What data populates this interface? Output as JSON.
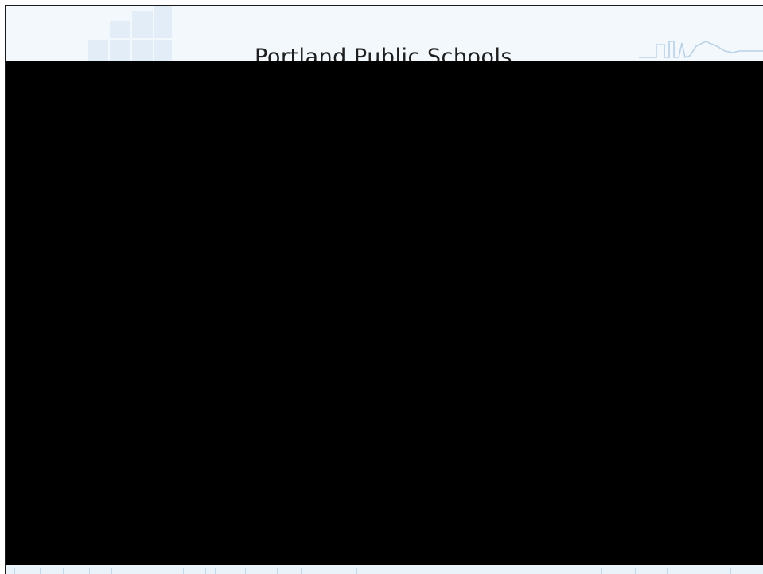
{
  "slide": {
    "title": "Portland Public Schools"
  },
  "colors": {
    "background": "#eef5fb",
    "accent": "#c9dcee",
    "content_block": "#000000",
    "title_text": "#1e1e1e"
  },
  "icons": {
    "header_graphic": "city-skyline-icon",
    "corner_graphic": "building-squares-icon"
  }
}
